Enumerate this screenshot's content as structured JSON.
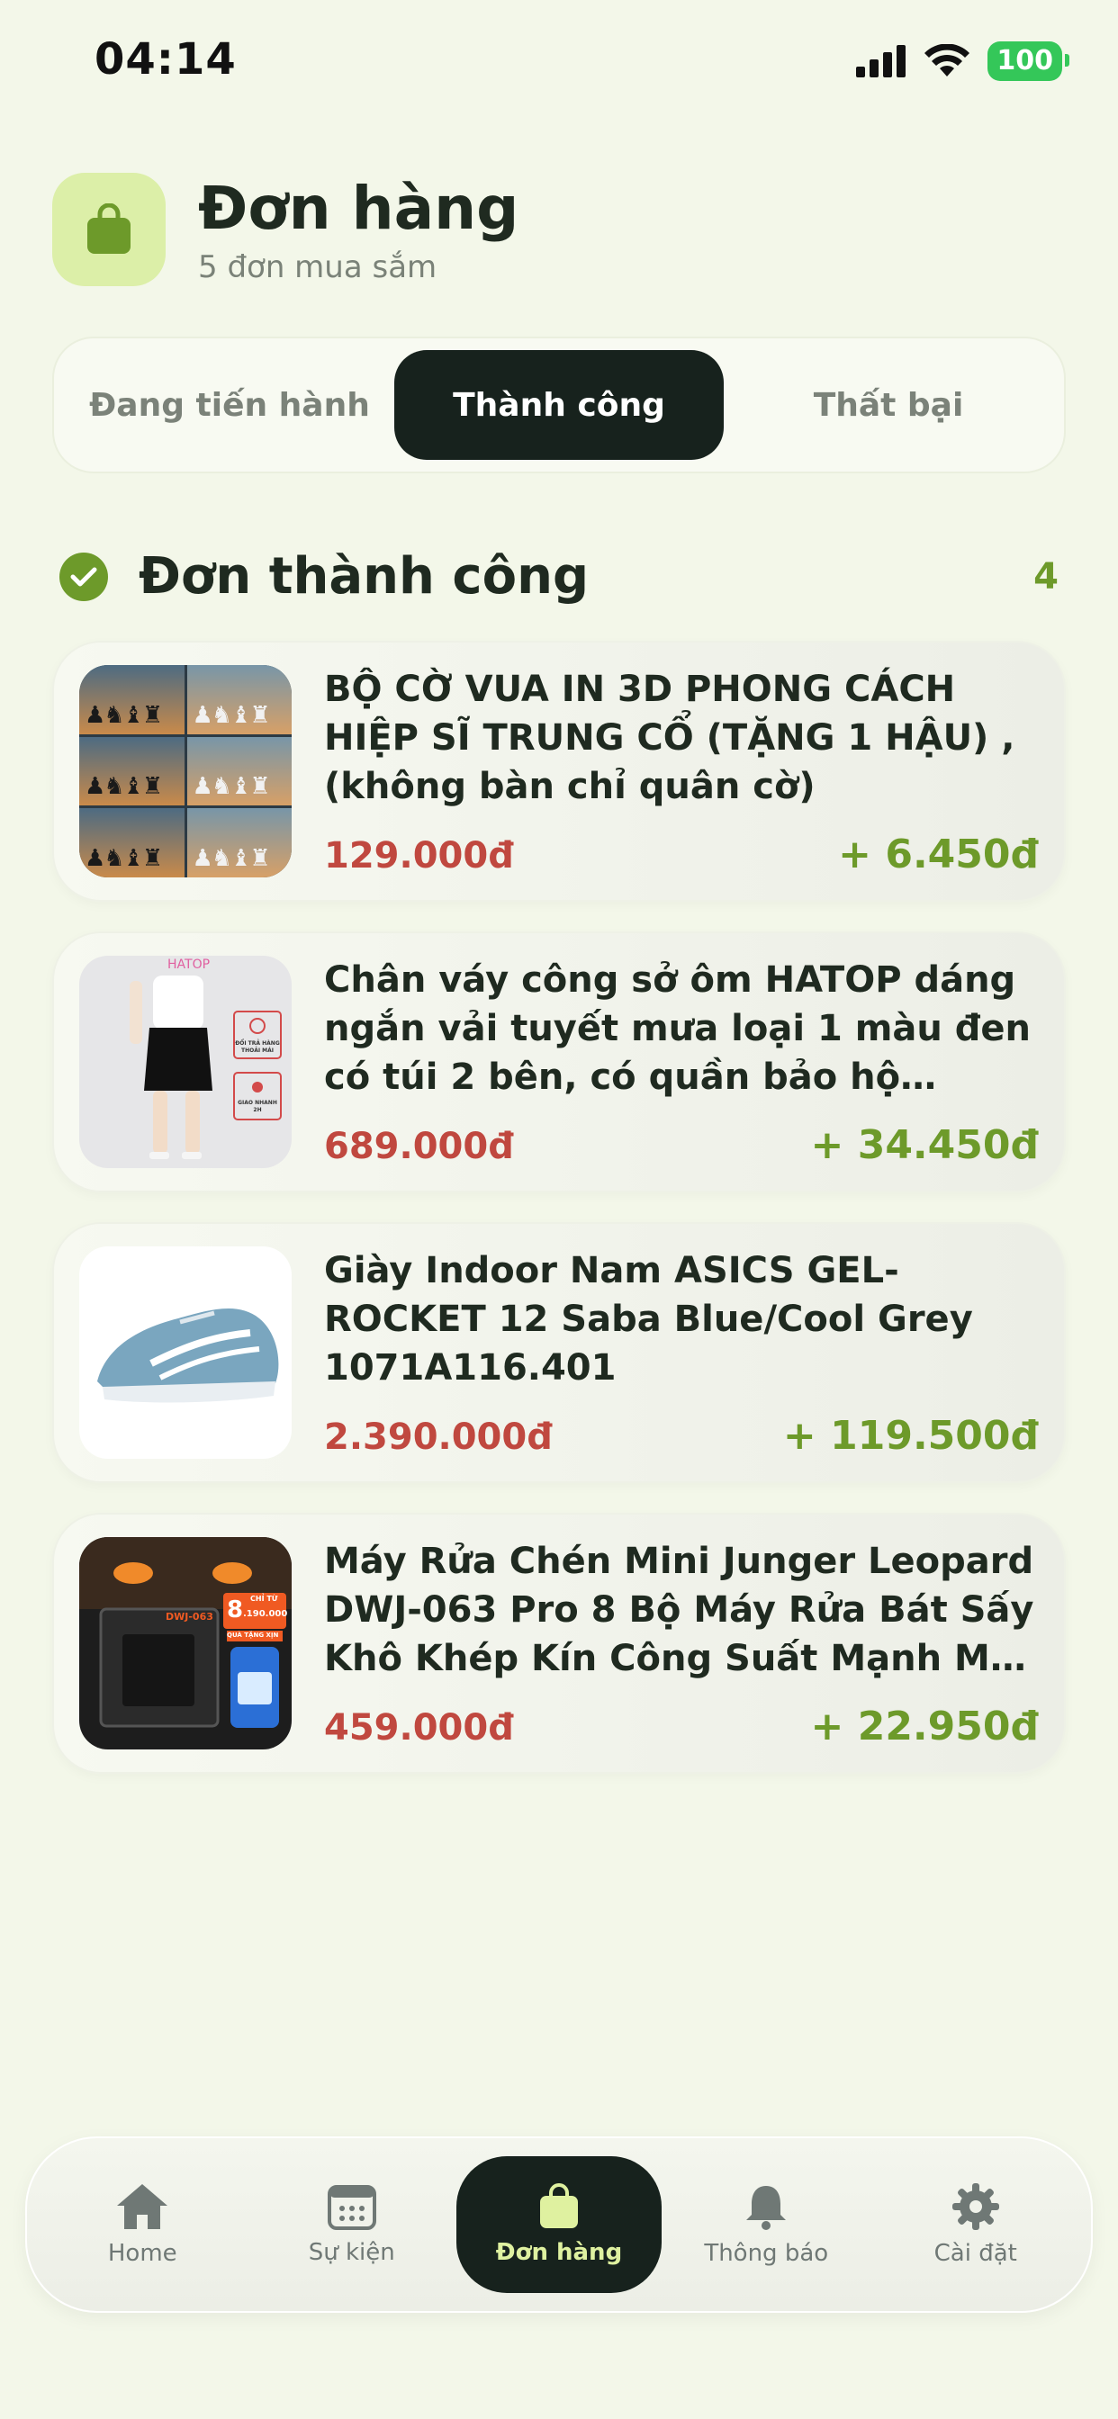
{
  "status_bar": {
    "time": "04:14",
    "battery": "100"
  },
  "header": {
    "title": "Đơn hàng",
    "subtitle": "5 đơn mua sắm",
    "icon": "shopping-bag-icon"
  },
  "tabs": [
    {
      "label": "Đang tiến hành",
      "active": false
    },
    {
      "label": "Thành công",
      "active": true
    },
    {
      "label": "Thất bại",
      "active": false
    }
  ],
  "section": {
    "title": "Đơn thành công",
    "count": "4"
  },
  "orders": [
    {
      "name": "BỘ CỜ VUA IN 3D PHONG CÁCH HIỆP SĨ TRUNG CỔ (TẶNG 1 HẬU) , (không bàn chỉ quân cờ)",
      "price": "129.000đ",
      "cashback": "+ 6.450đ"
    },
    {
      "name": "Chân váy công sở ôm HATOP dáng ngắn vải tuyết mưa loại 1 màu đen có túi 2 bên, có quần bảo hộ CVOD…",
      "price": "689.000đ",
      "cashback": "+ 34.450đ",
      "thumb_text": {
        "brand": "HATOP",
        "badge1": "ĐỔI TRẢ HÀNG THOẢI MÁI",
        "badge2": "GIAO NHANH 2H"
      }
    },
    {
      "name": "Giày Indoor Nam ASICS GEL-ROCKET 12 Saba Blue/Cool Grey 1071A116.401",
      "price": "2.390.000đ",
      "cashback": "+ 119.500đ"
    },
    {
      "name": "Máy Rửa Chén Mini Junger Leopard DWJ-063 Pro 8 Bộ Máy Rửa Bát Sấy Khô Khép Kín Công Suất Mạnh Mẽ …",
      "price": "459.000đ",
      "cashback": "+ 22.950đ",
      "thumb_text": {
        "model": "DWJ-063",
        "promo_prefix": "CHỈ TỪ",
        "promo_digit": "8",
        "promo_value": ".190.000",
        "gift": "QUÀ TẶNG XỊN"
      }
    }
  ],
  "nav": [
    {
      "label": "Home",
      "icon": "home-icon"
    },
    {
      "label": "Sự kiện",
      "icon": "calendar-icon"
    },
    {
      "label": "Đơn hàng",
      "icon": "shopping-bag-icon",
      "active": true
    },
    {
      "label": "Thông báo",
      "icon": "bell-icon"
    },
    {
      "label": "Cài đặt",
      "icon": "gear-icon"
    }
  ],
  "colors": {
    "accent": "#6d9a2a",
    "price": "#c0483f",
    "dark": "#17221d",
    "background": "#f3f7e9",
    "highlight": "#dff1a0"
  }
}
